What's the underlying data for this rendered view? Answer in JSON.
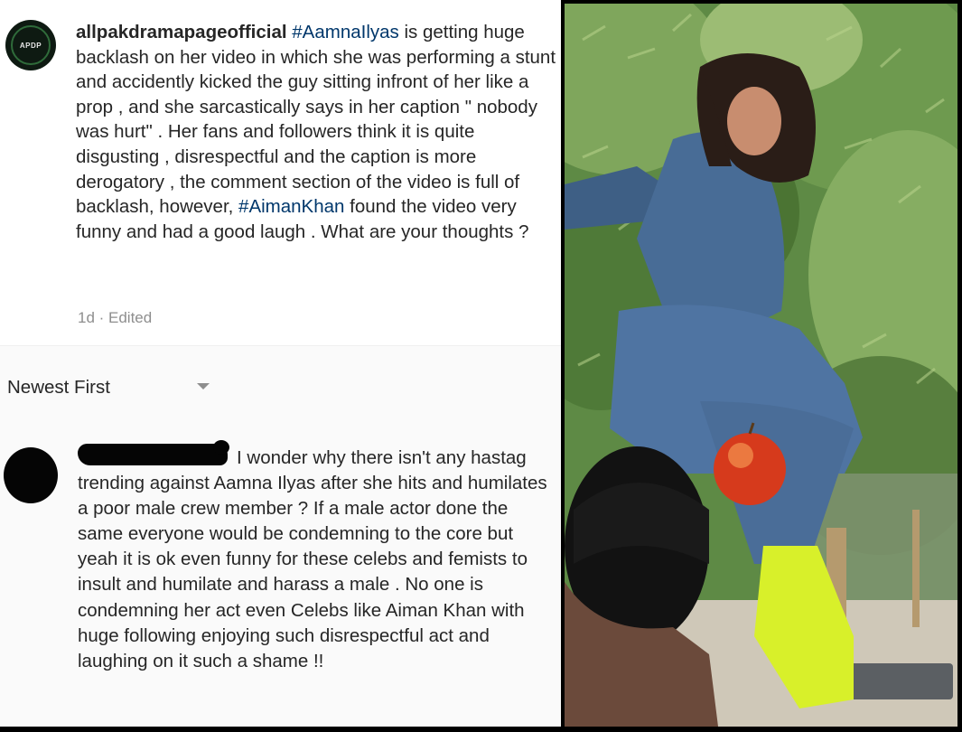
{
  "post": {
    "avatar_text": "APDP",
    "username": "allpakdramapageofficial",
    "hashtag_1": "#AamnaIlyas",
    "text_1": " is getting huge backlash on her video in which she was performing a stunt and accidently kicked the guy sitting infront of her like a prop , and she sarcastically says in her caption \" nobody was hurt\" . Her fans and followers think it is quite disgusting , disrespectful and the caption is more derogatory , the comment section of the video is full of backlash, however, ",
    "hashtag_2": "#AimanKhan",
    "text_2": " found the video very funny and had a good laugh . What are your thoughts ?",
    "meta": "1d · Edited"
  },
  "sort": {
    "label": "Newest First"
  },
  "comment": {
    "text": "I wonder why there isn't any hastag trending against Aamna Ilyas after she hits and humilates  a poor male crew member ? If a male actor done the same everyone would be condemning to the core but yeah it is ok even funny for these celebs and femists to insult and humilate and harass a male . No one is condemning her act even Celebs like Aiman Khan with huge following enjoying such disrespectful act and laughing on it such a shame !!"
  },
  "colors": {
    "hashtag": "#00376b",
    "meta": "#8e8e8e",
    "foliage": "#3f6b2c",
    "denim": "#4a6c93",
    "shoe": "#d8f02a",
    "apple": "#d63a1c"
  }
}
